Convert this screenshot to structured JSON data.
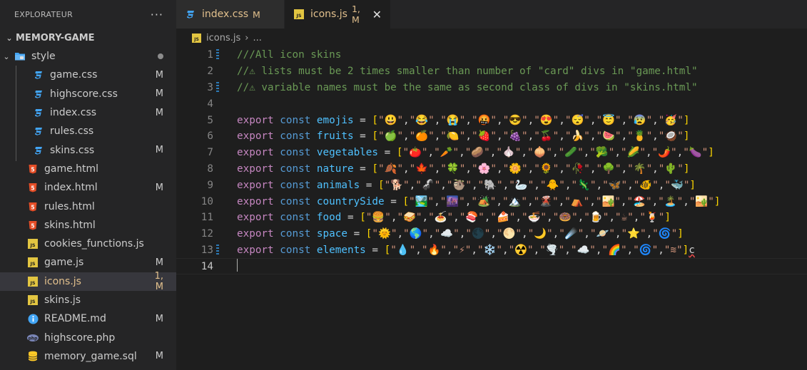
{
  "explorer": {
    "title": "EXPLORATEUR",
    "more": "···",
    "project": "MEMORY-GAME",
    "items": [
      {
        "name": "style",
        "type": "folder",
        "status": "",
        "dot": true,
        "indent": 20
      },
      {
        "name": "game.css",
        "type": "css",
        "status": "M",
        "indent": 46
      },
      {
        "name": "highscore.css",
        "type": "css",
        "status": "M",
        "indent": 46
      },
      {
        "name": "index.css",
        "type": "css",
        "status": "M",
        "indent": 46
      },
      {
        "name": "rules.css",
        "type": "css",
        "status": "",
        "indent": 46
      },
      {
        "name": "skins.css",
        "type": "css",
        "status": "M",
        "indent": 46
      },
      {
        "name": "game.html",
        "type": "html",
        "status": "",
        "indent": 38
      },
      {
        "name": "index.html",
        "type": "html",
        "status": "M",
        "indent": 38
      },
      {
        "name": "rules.html",
        "type": "html",
        "status": "",
        "indent": 38
      },
      {
        "name": "skins.html",
        "type": "html",
        "status": "",
        "indent": 38
      },
      {
        "name": "cookies_functions.js",
        "type": "js",
        "status": "",
        "indent": 38
      },
      {
        "name": "game.js",
        "type": "js",
        "status": "M",
        "indent": 38
      },
      {
        "name": "icons.js",
        "type": "js",
        "status": "1, M",
        "indent": 38,
        "active": true
      },
      {
        "name": "skins.js",
        "type": "js",
        "status": "",
        "indent": 38
      },
      {
        "name": "README.md",
        "type": "info",
        "status": "M",
        "indent": 38
      },
      {
        "name": "highscore.php",
        "type": "php",
        "status": "",
        "indent": 38
      },
      {
        "name": "memory_game.sql",
        "type": "sql",
        "status": "M",
        "indent": 38
      }
    ]
  },
  "tabs": [
    {
      "label": "index.css",
      "status": "M",
      "type": "css",
      "active": false
    },
    {
      "label": "icons.js",
      "status": "1, M",
      "type": "js",
      "active": true,
      "close": "✕"
    }
  ],
  "breadcrumb": {
    "file": "icons.js",
    "rest": "..."
  },
  "editor": {
    "comments": [
      "///All icon skins",
      "//⚠ lists must be 2 times smaller than number of \"card\" divs in \"game.html\"",
      "//⚠ variable names must be the same as second class of divs in \"skins.html\""
    ],
    "keywords": {
      "export": "export",
      "const": "const",
      "eq": " = ",
      "open": "[",
      "close": "]"
    },
    "arrays": [
      {
        "name": "emojis",
        "items": [
          "😃",
          "😂",
          "😭",
          "🤬",
          "😎",
          "😍",
          "😴",
          "😇",
          "😰",
          "🥳"
        ]
      },
      {
        "name": "fruits",
        "items": [
          "🍏",
          "🍊",
          "🍋",
          "🍓",
          "🍇",
          "🍒",
          "🍌",
          "🍉",
          "🍍",
          "🥥"
        ]
      },
      {
        "name": "vegetables",
        "items": [
          "🍅",
          "🥕",
          "🥔",
          "🧄",
          "🧅",
          "🥒",
          "🥦",
          "🌽",
          "🌶️",
          "🍆"
        ]
      },
      {
        "name": "nature",
        "items": [
          "🍂",
          "🍁",
          "🍀",
          "🌸",
          "🌼",
          "🌻",
          "🥀",
          "🌳",
          "🌴",
          "🌵"
        ]
      },
      {
        "name": "animals",
        "items": [
          "🐕",
          "🦨",
          "🦥",
          "🐘",
          "🦢",
          "🐥",
          "🦎",
          "🦋",
          "🐠",
          "🐳"
        ]
      },
      {
        "name": "countrySide",
        "items": [
          "🏞️",
          "🌆",
          "🏕️",
          "🏔️",
          "🌋",
          "⛺",
          "🏜️",
          "🏖️",
          "🏝️",
          "🏜️"
        ]
      },
      {
        "name": "food",
        "items": [
          "🍔",
          "🥪",
          "🍝",
          "🍣",
          "🍰",
          "🍜",
          "🍩",
          "🍺",
          "☕",
          "🍹"
        ]
      },
      {
        "name": "space",
        "items": [
          "🌞",
          "🌎",
          "☁️",
          "🌑",
          "🌕",
          "🌙",
          "☄️",
          "🪐",
          "⭐",
          "🌀"
        ]
      },
      {
        "name": "elements",
        "items": [
          "💧",
          "🔥",
          "⚡",
          "❄️",
          "☢️",
          "🌪️",
          "☁️",
          "🌈",
          "🌀",
          "≋"
        ],
        "trailing": "c"
      }
    ]
  }
}
